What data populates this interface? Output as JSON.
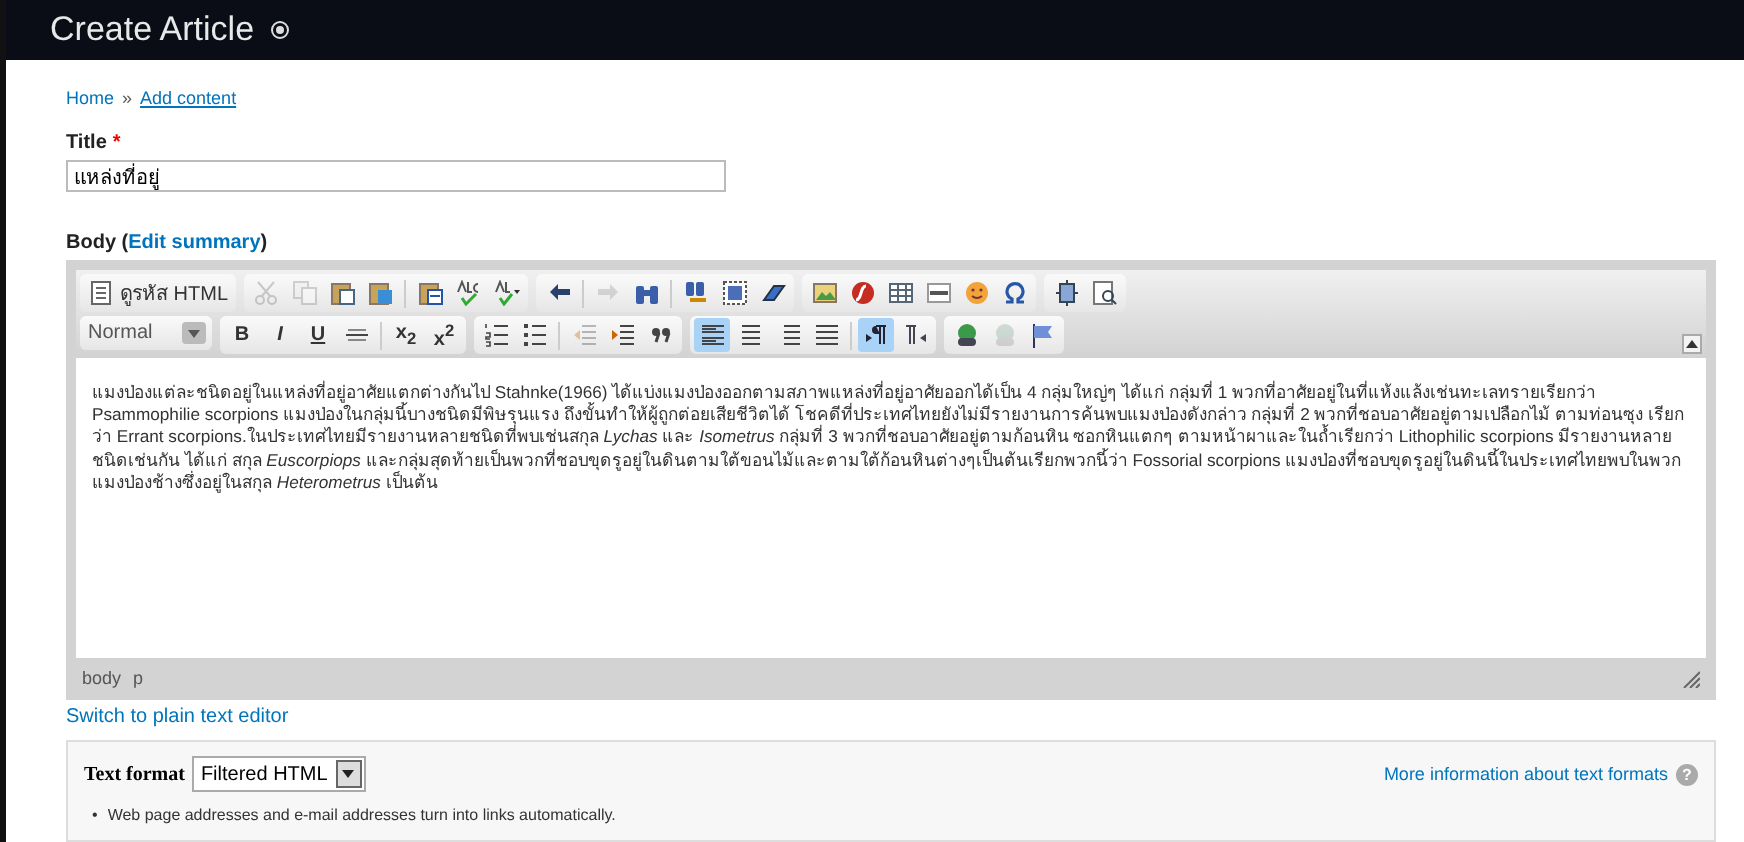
{
  "page_title": "Create Article",
  "breadcrumb": [
    {
      "label": "Home",
      "underlined": false
    },
    {
      "label": "Add content",
      "underlined": true
    }
  ],
  "breadcrumb_separator": "»",
  "title_field": {
    "label": "Title",
    "required_mark": "*",
    "value": "แหล่งที่อยู่"
  },
  "body_field": {
    "label": "Body",
    "paren_open": "(",
    "link": "Edit summary",
    "paren_close": ")"
  },
  "toolbar": {
    "source_label": "ดูรหัส HTML",
    "format": "Normal",
    "row1": [
      {
        "disabled": true
      },
      {
        "disabled": true
      },
      {
        "disabled": false
      },
      {
        "disabled": false
      },
      {
        "disabled": false
      },
      {
        "disabled": false
      },
      {
        "disabled": false
      },
      {
        "disabled": false
      },
      {
        "disabled": true
      },
      {
        "disabled": false
      },
      {
        "disabled": false
      },
      {
        "disabled": false
      },
      {
        "disabled": false
      },
      {
        "disabled": false
      },
      {
        "disabled": false
      },
      {
        "disabled": false
      },
      {
        "disabled": false
      },
      {
        "disabled": false
      },
      {
        "disabled": false
      },
      {
        "disabled": false
      },
      {
        "disabled": false
      }
    ],
    "row2": [
      {
        "label": "B",
        "selected": false,
        "disabled": false
      },
      {
        "label": "I",
        "selected": false,
        "disabled": false
      },
      {
        "label": "U",
        "selected": false,
        "disabled": false
      },
      {
        "selected": false,
        "disabled": false
      },
      {
        "label": "x$_{2}$",
        "selected": false,
        "disabled": false
      },
      {
        "label": "x$^{2}$",
        "selected": false,
        "disabled": false
      },
      {
        "selected": false,
        "disabled": false
      },
      {
        "selected": false,
        "disabled": false
      },
      {
        "selected": false,
        "disabled": true
      },
      {
        "selected": false,
        "disabled": false
      },
      {
        "selected": false,
        "disabled": false
      },
      {
        "selected": true,
        "disabled": false
      },
      {
        "selected": false,
        "disabled": false
      },
      {
        "selected": false,
        "disabled": false
      },
      {
        "selected": false,
        "disabled": false
      },
      {
        "selected": true,
        "disabled": false
      },
      {
        "selected": false,
        "disabled": false
      },
      {
        "selected": false,
        "disabled": false
      },
      {
        "selected": false,
        "disabled": true
      },
      {
        "selected": false,
        "disabled": false
      }
    ]
  },
  "editor_text": "แมงป่องแต่ละชนิดอยู่ในแหล่งที่อยู่อาศัยแตกต่างกันไป Stahnke(1966) ได้แบ่งแมงป่องออกตามสภาพแหล่งที่อยู่อาศัยออกได้เป็น 4 กลุ่มใหญ่ๆ ได้แก่ กลุ่มที่ 1 พวกที่อาศัยอยู่ในที่แห้งแล้งเช่นทะเลทรายเรียกว่า Psammophilie scorpions แมงป่องในกลุ่มนี้บางชนิดมีพิษรุนแรง ถึงขั้นทำให้ผู้ถูกต่อยเสียชีวิตได้ โชคดีที่ประเทศไทยยังไม่มีรายงานการค้นพบแมงป่องดังกล่าว กลุ่มที่ 2 พวกที่ชอบอาศัยอยู่ตามเปลือกไม้ ตามท่อนซุง เรียกว่า Errant scorpions.ในประเทศไทยมีรายงานหลายชนิดที่พบเช่นสกุล *Lychas* และ *Isometrus* กลุ่มที่ 3 พวกที่ชอบอาศัยอยู่ตามก้อนหิน ซอกหินแตกๆ ตามหน้าผาและในถ้ำเรียกว่า Lithophilic scorpions มีรายงานหลายชนิดเช่นกัน ได้แก่ สกุล *Euscorpiops* และกลุ่มสุดท้ายเป็นพวกที่ชอบขุดรูอยู่ในดินตามใต้ขอนไม้และตามใต้ก้อนหินต่างๆเป็นต้นเรียกพวกนี้ว่า Fossorial scorpions แมงป่องที่ชอบขุดรูอยู่ในดินนี้ในประเทศไทยพบในพวกแมงป่องช้างซึ่งอยู่ในสกุล *Heterometrus* เป็นต้น",
  "editor_path": [
    "body",
    "p"
  ],
  "switch_link": "Switch to plain text editor",
  "text_format": {
    "label": "Text format",
    "value": "Filtered HTML",
    "help_link": "More information about text formats",
    "help_glyph": "?",
    "tip_bullet": "•",
    "tips": [
      "Web page addresses and e-mail addresses turn into links automatically."
    ]
  }
}
